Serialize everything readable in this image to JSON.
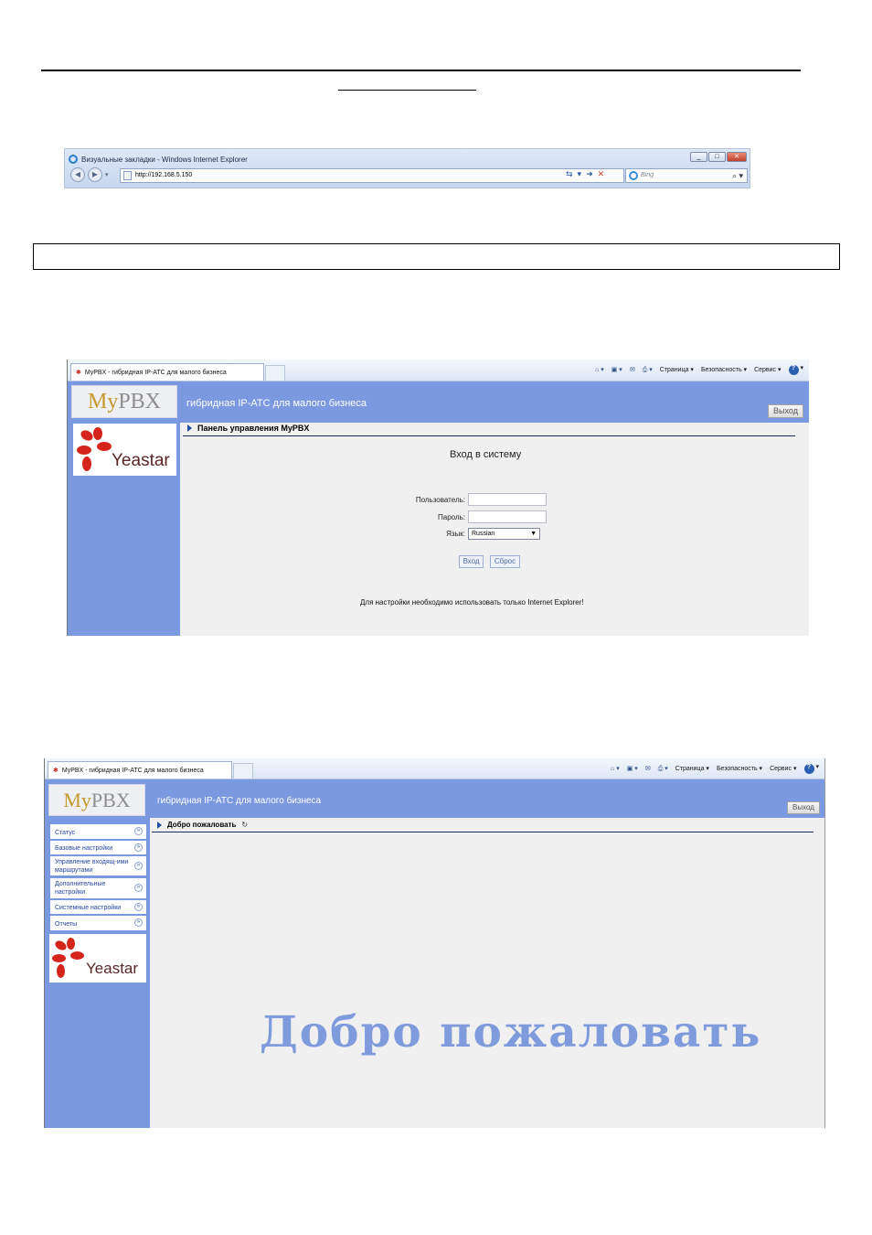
{
  "ie_window": {
    "title": "Визуальные закладки - Windows Internet Explorer",
    "address": "http://192.168.5.150",
    "search_placeholder": "Bing",
    "buttons": [
      "_",
      "□",
      "✕"
    ]
  },
  "browser_tab_title": "MyPBX - гибридная IP-АТС для малого бизнеса",
  "browser_tools": {
    "page": "Страница",
    "safety": "Безопасность",
    "service": "Сервис"
  },
  "brand": {
    "my": "My",
    "pbx": "PBX",
    "subtitle": "гибридная IP-АТС для малого бизнеса",
    "logout": "Выход",
    "yeastar": "Yeastar"
  },
  "login": {
    "breadcrumb": "Панель управления MyPBX",
    "title": "Вход в систему",
    "user_label": "Пользователь:",
    "password_label": "Пароль:",
    "language_label": "Язык:",
    "language_value": "Russian",
    "login_button": "Вход",
    "reset_button": "Сброс",
    "note": "Для настройки необходимо использовать только Internet Explorer!"
  },
  "dashboard": {
    "breadcrumb": "Добро пожаловать",
    "menu": [
      {
        "label": "Статус"
      },
      {
        "label": "Базовые настройки"
      },
      {
        "label": "Управление входящ-ими маршрутами"
      },
      {
        "label": "Дополнительные настройки"
      },
      {
        "label": "Системные настройки"
      },
      {
        "label": "Отчеты"
      }
    ],
    "welcome": "Добро пожаловать"
  }
}
